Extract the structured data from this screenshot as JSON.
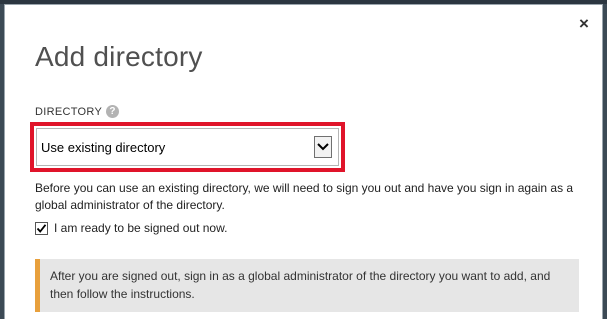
{
  "dialog": {
    "close_symbol": "×",
    "title": "Add directory",
    "directory_label": "DIRECTORY",
    "help_symbol": "?",
    "select": {
      "selected_value": "Use existing directory"
    },
    "notice": "Before you can use an existing directory, we will need to sign you out and have you sign in again as a global administrator of the directory.",
    "checkbox": {
      "checked": true,
      "label": "I am ready to be signed out now."
    },
    "info": "After you are signed out, sign in as a global administrator of the directory you want to add, and then follow the instructions."
  },
  "colors": {
    "highlight": "#e0142a",
    "info_accent": "#e8a03c",
    "info_background": "#e6e6e6"
  }
}
